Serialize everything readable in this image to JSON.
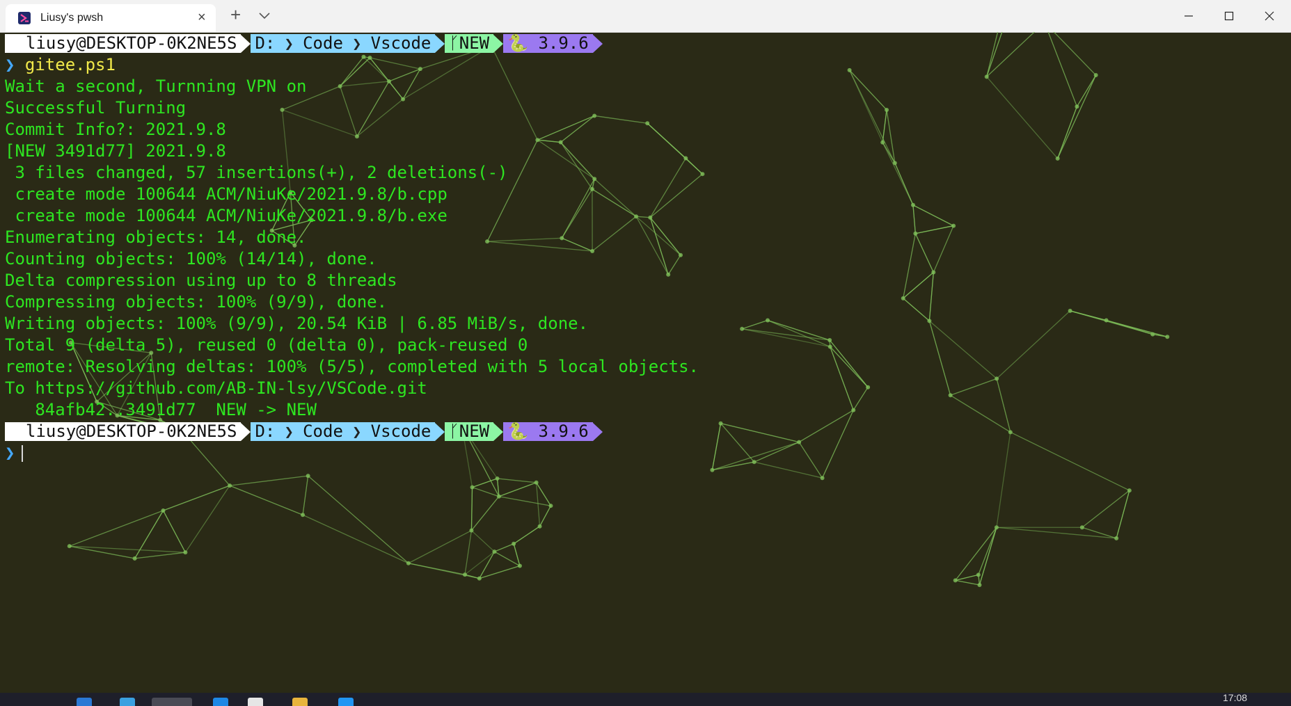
{
  "window": {
    "tab_title": "Liusy's pwsh"
  },
  "prompt": {
    "user": "liusy@DESKTOP-0K2NE5S",
    "path": [
      "D:",
      "Code",
      "Vscode"
    ],
    "git_branch": "NEW",
    "python_version": "3.9.6"
  },
  "command": "gitee.ps1",
  "output": [
    "Wait a second, Turnning VPN on",
    "Successful Turning",
    "Commit Info?: 2021.9.8",
    "[NEW 3491d77] 2021.9.8",
    " 3 files changed, 57 insertions(+), 2 deletions(-)",
    " create mode 100644 ACM/NiuKe/2021.9.8/b.cpp",
    " create mode 100644 ACM/NiuKe/2021.9.8/b.exe",
    "Enumerating objects: 14, done.",
    "Counting objects: 100% (14/14), done.",
    "Delta compression using up to 8 threads",
    "Compressing objects: 100% (9/9), done.",
    "Writing objects: 100% (9/9), 20.54 KiB | 6.85 MiB/s, done.",
    "Total 9 (delta 5), reused 0 (delta 0), pack-reused 0",
    "remote: Resolving deltas: 100% (5/5), completed with 5 local objects.",
    "To https://github.com/AB-IN-lsy/VSCode.git",
    "   84afb42..3491d77  NEW -> NEW"
  ],
  "taskbar": {
    "clock": "17:08"
  },
  "colors": {
    "background": "#2a2a16",
    "output_text": "#2ee621",
    "command_text": "#f1e94a",
    "user_segment": "#ffffff",
    "path_segment": "#8ad7ff",
    "git_segment": "#8cf5a4",
    "python_segment": "#9b79f0",
    "network_lines": "#7fbf5a"
  },
  "icons": {
    "tab": "powershell-icon",
    "new_tab": "plus-icon",
    "dropdown": "chevron-down-icon",
    "minimize": "minimize-icon",
    "maximize": "maximize-icon",
    "close": "close-icon",
    "git": "git-branch-icon",
    "python": "python-icon",
    "prompt": "chevron-right-icon"
  }
}
